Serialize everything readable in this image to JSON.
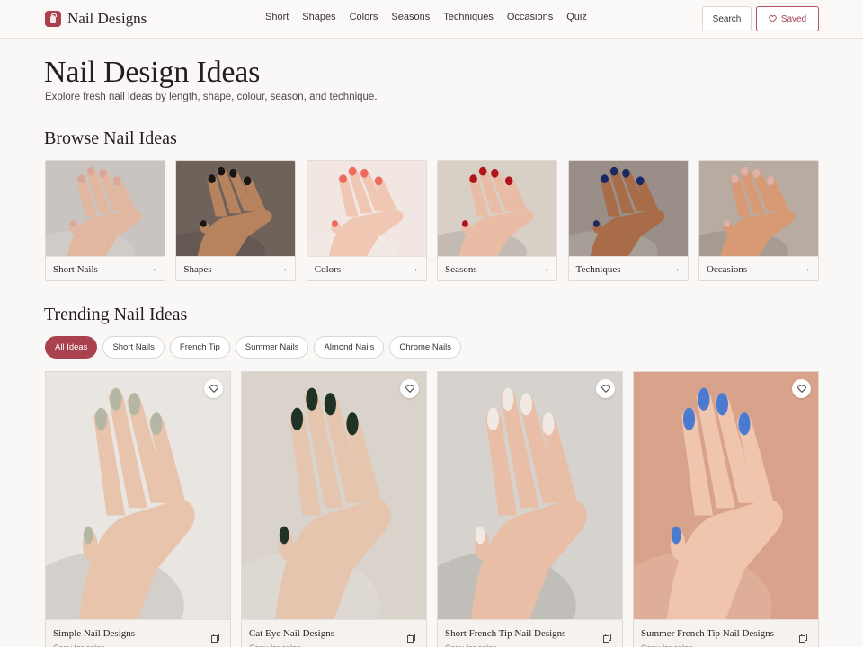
{
  "header": {
    "brand": "Nail Designs",
    "nav": [
      "Short",
      "Shapes",
      "Colors",
      "Seasons",
      "Techniques",
      "Occasions",
      "Quiz"
    ],
    "search_label": "Search",
    "saved_label": "Saved"
  },
  "hero": {
    "title": "Nail Design Ideas",
    "subtitle": "Explore fresh nail ideas by length, shape, colour, season, and technique."
  },
  "browse": {
    "title": "Browse Nail Ideas",
    "categories": [
      {
        "label": "Short Nails",
        "polish": "#d9a79a",
        "skin": "#e2b79f",
        "bg": "#c9c4bf"
      },
      {
        "label": "Shapes",
        "polish": "#171515",
        "skin": "#b7825e",
        "bg": "#6e625b"
      },
      {
        "label": "Colors",
        "polish": "#ef6a5c",
        "skin": "#f0c7b3",
        "bg": "#f1e6e2"
      },
      {
        "label": "Seasons",
        "polish": "#b1141d",
        "skin": "#e9bda5",
        "bg": "#d8cfc6"
      },
      {
        "label": "Techniques",
        "polish": "#182a63",
        "skin": "#a86d48",
        "bg": "#9a8f88"
      },
      {
        "label": "Occasions",
        "polish": "#e0b1a8",
        "skin": "#d79a74",
        "bg": "#b8aba2"
      }
    ]
  },
  "trending": {
    "title": "Trending Nail Ideas",
    "filters": [
      "All Ideas",
      "Short Nails",
      "French Tip",
      "Summer Nails",
      "Almond Nails",
      "Chrome Nails"
    ],
    "active_filter": 0,
    "cards": [
      {
        "title": "Simple Nail Designs",
        "meta": "Copy for salon",
        "bg": "#e9e5e1",
        "skin": "#e9c4ad",
        "polish": "#b5b7a5"
      },
      {
        "title": "Cat Eye Nail Designs",
        "meta": "Copy for salon",
        "bg": "#d9d3cc",
        "skin": "#e6c5ae",
        "polish": "#1f3226"
      },
      {
        "title": "Short French Tip Nail Designs",
        "meta": "Copy for salon",
        "bg": "#d6d2cd",
        "skin": "#e8bfa6",
        "polish": "#f3e9e3"
      },
      {
        "title": "Summer French Tip Nail Designs",
        "meta": "Copy for salon",
        "bg": "#d9a28a",
        "skin": "#f0c5ad",
        "polish": "#4a7bd1"
      }
    ]
  },
  "colors": {
    "accent": "#a9414f",
    "background": "#faf8f6"
  }
}
